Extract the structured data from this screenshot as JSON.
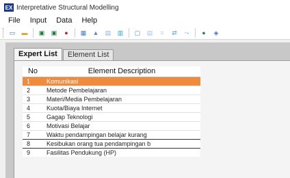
{
  "window": {
    "title": "Interpretative Structural Modelling",
    "icon_label": "EX"
  },
  "menu": {
    "items": [
      "File",
      "Input",
      "Data",
      "Help"
    ]
  },
  "toolbar": {
    "buttons": [
      {
        "icon": "new-icon",
        "glyph": "▭",
        "color": "#2f6fc0"
      },
      {
        "icon": "open-folder-icon",
        "glyph": "▬",
        "color": "#e0a21c"
      },
      {
        "icon": "save-icon",
        "glyph": "▣",
        "color": "#1c7a3a"
      },
      {
        "icon": "save-as-icon",
        "glyph": "▣",
        "color": "#1c7a3a"
      },
      {
        "icon": "stop-icon",
        "glyph": "●",
        "color": "#c2202a"
      },
      {
        "icon": "grid-icon",
        "glyph": "▦",
        "color": "#4a7acb"
      },
      {
        "icon": "chart-icon",
        "glyph": "▲",
        "color": "#6b86c7"
      },
      {
        "icon": "table-icon",
        "glyph": "▤",
        "color": "#8fb0e6"
      },
      {
        "icon": "matrix-icon",
        "glyph": "▥",
        "color": "#2ba1c5"
      },
      {
        "icon": "window-icon",
        "glyph": "▢",
        "color": "#3d8ee0"
      },
      {
        "icon": "list-icon",
        "glyph": "▤",
        "color": "#9ec3ee"
      },
      {
        "icon": "filter-icon",
        "glyph": "≡",
        "color": "#b8cfee"
      },
      {
        "icon": "arrows-icon",
        "glyph": "⇄",
        "color": "#5da6d9"
      },
      {
        "icon": "flow-icon",
        "glyph": "⤳",
        "color": "#7fb7e0"
      },
      {
        "icon": "link-icon",
        "glyph": "●",
        "color": "#2b8a3e"
      },
      {
        "icon": "diagram-icon",
        "glyph": "◈",
        "color": "#3b73c4"
      }
    ]
  },
  "tabs": [
    "Expert List",
    "Element List"
  ],
  "grid": {
    "headers": {
      "no": "No",
      "description": "Element Description"
    },
    "rows": [
      {
        "no": "1",
        "description": "Komunikasi"
      },
      {
        "no": "2",
        "description": "Metode Pembelajaran"
      },
      {
        "no": "3",
        "description": "Materi/Media Pembelajaran"
      },
      {
        "no": "4",
        "description": "Kuota/Biaya Internet"
      },
      {
        "no": "5",
        "description": "Gagap Teknologi"
      },
      {
        "no": "6",
        "description": "Motivasi Belajar"
      },
      {
        "no": "7",
        "description": "Waktu pendampingan belajar kurang"
      },
      {
        "no": "8",
        "description": "Kesibukan orang tua pendampingan b"
      },
      {
        "no": "9",
        "description": "Fasilitas Pendukung (HP)"
      }
    ],
    "selected_row": "1",
    "selected_color": "#f08a3c"
  }
}
